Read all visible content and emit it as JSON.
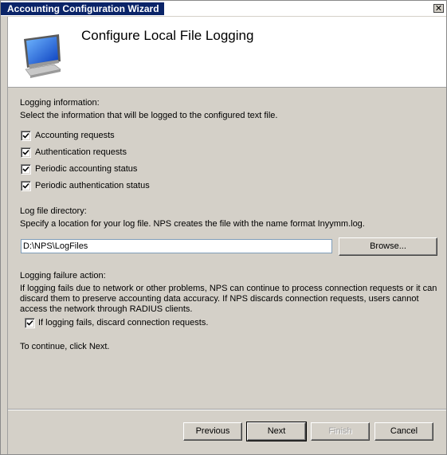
{
  "window": {
    "title": "Accounting Configuration Wizard",
    "close_glyph": "✕"
  },
  "header": {
    "title": "Configure Local File Logging",
    "icon": "monitor-icon"
  },
  "logging_info": {
    "heading": "Logging information:",
    "description": "Select the information that will be logged to the configured text file.",
    "options": [
      {
        "label": "Accounting requests",
        "checked": true
      },
      {
        "label": "Authentication requests",
        "checked": true
      },
      {
        "label": "Periodic accounting status",
        "checked": true
      },
      {
        "label": "Periodic authentication status",
        "checked": true
      }
    ]
  },
  "log_dir": {
    "heading": "Log file directory:",
    "description": "Specify a location for your log file. NPS creates the file with the name format Inyymm.log.",
    "value": "D:\\NPS\\LogFiles",
    "browse_label": "Browse..."
  },
  "failure": {
    "heading": "Logging failure action:",
    "line1": "If logging fails due to network or other problems, NPS can  continue to process connection requests or it can",
    "line2": "discard them to preserve accounting data accuracy. If NPS discards connection requests, users cannot",
    "line3": "access the network through RADIUS clients.",
    "option_label": "If logging fails, discard connection requests.",
    "option_checked": true
  },
  "footer_hint": "To continue, click Next.",
  "buttons": {
    "previous": "Previous",
    "next": "Next",
    "finish": "Finish",
    "cancel": "Cancel"
  }
}
